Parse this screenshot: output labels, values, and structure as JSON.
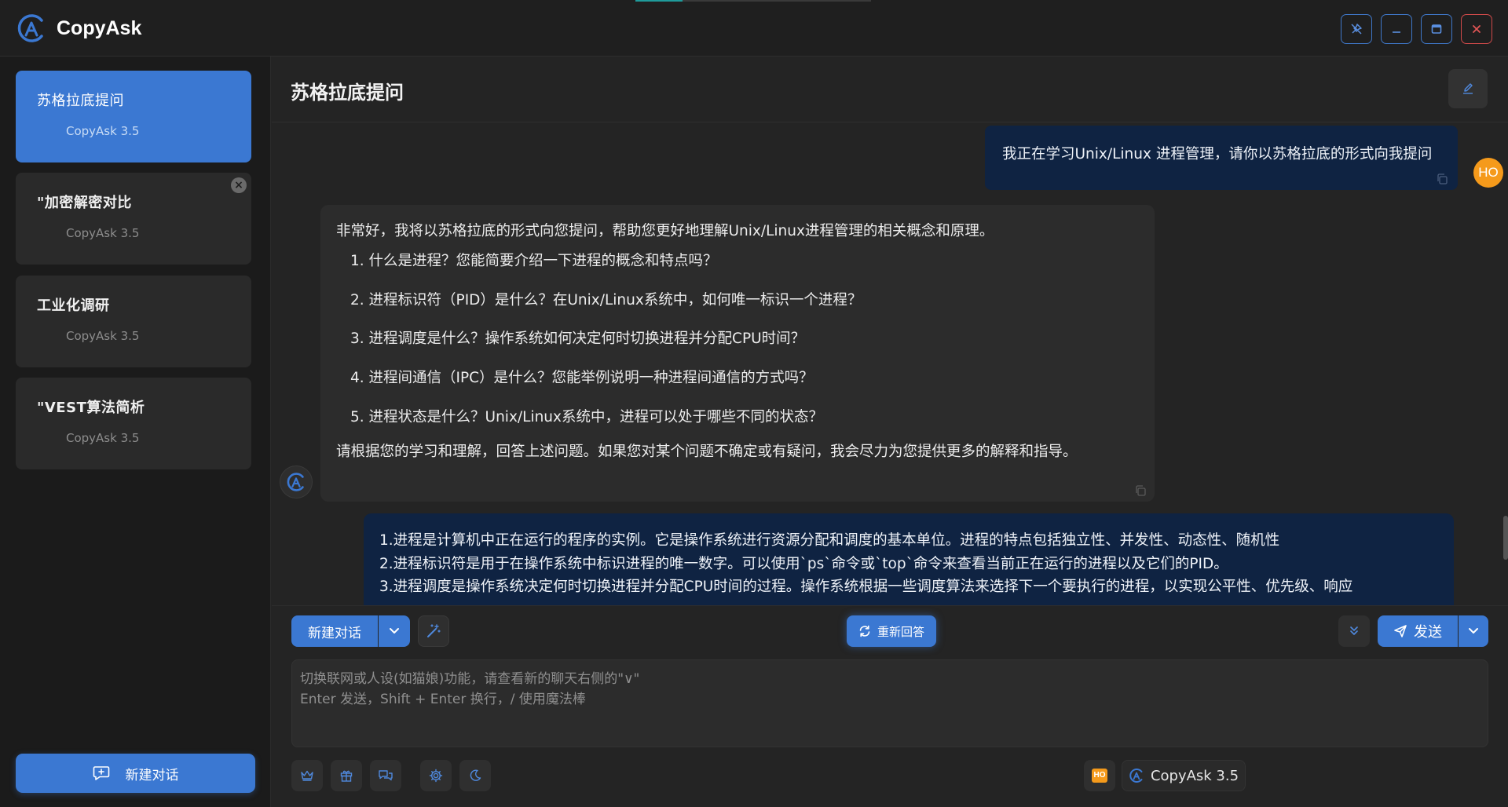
{
  "app": {
    "name": "CopyAsk"
  },
  "window_controls": [
    "pin-icon",
    "minimize-icon",
    "maximize-icon",
    "close-icon"
  ],
  "sidebar": {
    "conversations": [
      {
        "title": "苏格拉底提问",
        "model": "CopyAsk 3.5",
        "active": true
      },
      {
        "title": "\"加密解密对比",
        "model": "CopyAsk 3.5",
        "active": false
      },
      {
        "title": "工业化调研",
        "model": "CopyAsk 3.5",
        "active": false
      },
      {
        "title": "\"VEST算法简析",
        "model": "CopyAsk 3.5",
        "active": false
      }
    ],
    "new_chat_label": "新建对话"
  },
  "main": {
    "title": "苏格拉底提问",
    "messages": {
      "user1": "我正在学习Unix/Linux 进程管理，请你以苏格拉底的形式向我提问",
      "user_avatar": "HO",
      "bot1": {
        "intro": "非常好，我将以苏格拉底的形式向您提问，帮助您更好地理解Unix/Linux进程管理的相关概念和原理。",
        "items": [
          "1. 什么是进程？您能简要介绍一下进程的概念和特点吗？",
          "2. 进程标识符（PID）是什么？在Unix/Linux系统中，如何唯一标识一个进程？",
          "3. 进程调度是什么？操作系统如何决定何时切换进程并分配CPU时间？",
          "4. 进程间通信（IPC）是什么？您能举例说明一种进程间通信的方式吗？",
          "5. 进程状态是什么？Unix/Linux系统中，进程可以处于哪些不同的状态？"
        ],
        "closing": "请根据您的学习和理解，回答上述问题。如果您对某个问题不确定或有疑问，我会尽力为您提供更多的解释和指导。"
      },
      "user2": [
        "1.进程是计算机中正在运行的程序的实例。它是操作系统进行资源分配和调度的基本单位。进程的特点包括独立性、并发性、动态性、随机性",
        "2.进程标识符是用于在操作系统中标识进程的唯一数字。可以使用`ps`命令或`top`命令来查看当前正在运行的进程以及它们的PID。",
        "3.进程调度是操作系统决定何时切换进程并分配CPU时间的过程。操作系统根据一些调度算法来选择下一个要执行的进程，以实现公平性、优先级、响应"
      ]
    }
  },
  "composer": {
    "new_chat_label": "新建对话",
    "regenerate_label": "重新回答",
    "send_label": "发送",
    "input_placeholder": "切换联网或人设(如猫娘)功能，请查看新的聊天右侧的\"∨\"\nEnter 发送，Shift + Enter 换行，/ 使用魔法棒",
    "tool_icons": [
      "crown-icon",
      "gift-icon",
      "chat-bubbles-icon",
      "gear-icon",
      "moon-icon"
    ],
    "user_badge": "HO",
    "model_label": "CopyAsk 3.5"
  },
  "colors": {
    "accent": "#3b78d2",
    "user_bubble": "#0f2342",
    "avatar": "#f59a1b",
    "close": "#d04a4a"
  }
}
